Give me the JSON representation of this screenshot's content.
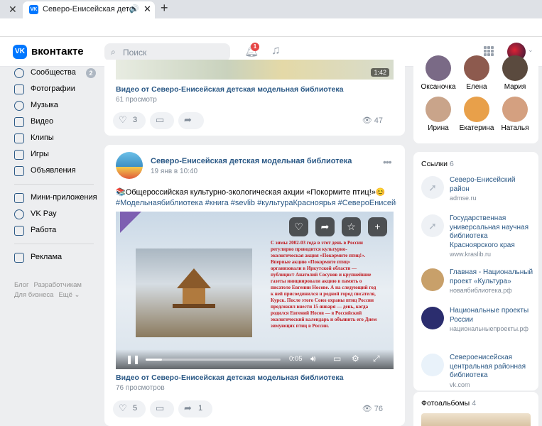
{
  "browser": {
    "tab_title": "Северо-Енисейская детска",
    "new_tab": "+",
    "close": "✕",
    "audio": "🔊"
  },
  "header": {
    "brand": "вконтакте",
    "search_placeholder": "Поиск",
    "notifications_count": "1"
  },
  "nav": {
    "items": [
      {
        "label": "Сообщества",
        "badge": "2"
      },
      {
        "label": "Фотографии"
      },
      {
        "label": "Музыка"
      },
      {
        "label": "Видео"
      },
      {
        "label": "Клипы"
      },
      {
        "label": "Игры"
      },
      {
        "label": "Объявления"
      },
      {
        "label": "Мини-приложения"
      },
      {
        "label": "VK Pay"
      },
      {
        "label": "Работа"
      },
      {
        "label": "Реклама"
      }
    ],
    "footer": [
      "Блог",
      "Разработчикам",
      "Для бизнеса",
      "Ещё ⌄"
    ]
  },
  "post1": {
    "duration": "1:42",
    "video_title": "Видео от Северо-Енисейская детская модельная библиотека",
    "views_text": "61 просмотр",
    "likes": "3",
    "views": "47"
  },
  "post2": {
    "author": "Северо-Енисейская детская модельная библиотека",
    "date": "19 янв в 10:40",
    "text": "📚Общероссийская культурно-экологическая акции «Покормите птиц!»😊",
    "tags": "#Модельнаябиблиотека #книга #sevlib #культураКрасноярья #СевероЕнисейский",
    "video_overlay_text": "С зимы 2002-03 года в этот день в России регулярно проводится культурно-экологическая акция «Покормите птиц!». Впервые акцию «Покормите птиц» организовали в Иркутской области — публицист Анатолий Сосунов и крупнейшие газеты инициировали акцию в память о писателе Евгении Носове. А на следующий год к ней присоединился и родной город писателя, Курск. После этого Союз охраны птиц России предложил внести 15 января — день, когда родился Евгений Носов — в Российский экологический календарь и объявить его Днем зимующих птиц в России.",
    "video_time": "0:05",
    "video_progress": 0.12,
    "video_title": "Видео от Северо-Енисейская детская модельная библиотека",
    "views_text": "76 просмотров",
    "likes": "5",
    "reposts": "1",
    "views": "76"
  },
  "friends": [
    {
      "name": "Оксаночка",
      "color": "#7a6a86"
    },
    {
      "name": "Елена",
      "color": "#8d5a4e"
    },
    {
      "name": "Мария",
      "color": "#5a4a3e"
    },
    {
      "name": "Ирина",
      "color": "#c9a48a"
    },
    {
      "name": "Екатерина",
      "color": "#e8a04a"
    },
    {
      "name": "Наталья",
      "color": "#d4a080"
    }
  ],
  "links": {
    "title": "Ссылки",
    "count": "6",
    "items": [
      {
        "title": "Северо-Енисейский район",
        "domain": "admse.ru"
      },
      {
        "title": "Государственная универсальная научная библиотека Красноярского края",
        "domain": "www.kraslib.ru"
      },
      {
        "title": "Главная - Национальный проект «Культура»",
        "domain": "новаябиблиотека.рф"
      },
      {
        "title": "Национальные проекты России",
        "domain": "национальныепроекты.рф"
      },
      {
        "title": "Североенисейская центральная районная библиотека",
        "domain": "vk.com"
      }
    ]
  },
  "albums": {
    "title": "Фотоальбомы",
    "count": "4"
  },
  "colors": {
    "accent": "#0077ff",
    "link": "#2a5885",
    "bg": "#edeef0"
  }
}
